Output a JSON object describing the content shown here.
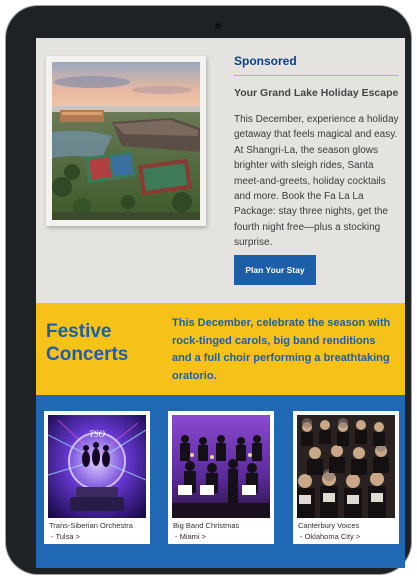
{
  "sponsored": {
    "label": "Sponsored",
    "title": "Your Grand Lake Holiday Escape",
    "body": "This December, experience a holiday getaway that feels magical and easy. At Shangri-La, the season glows brighter with sleigh rides, Santa meet-and-greets, holiday cocktails and more. Book the Fa La La Package: stay three nights, get the fourth night free—plus a stocking surprise.",
    "button_label": "Plan Your Stay"
  },
  "festive": {
    "title": "Festive Concerts",
    "body": "This December, celebrate the season with rock-tinged carols, big band renditions and a full choir performing a breathtaking oratorio."
  },
  "concerts": [
    {
      "name": "Trans-Siberian Orchestra",
      "city": "- Tulsa >"
    },
    {
      "name": "Big Band Christmas",
      "city": "- Miami >"
    },
    {
      "name": "Canterbury Voices",
      "city": "- Oklahoma City >"
    }
  ],
  "colors": {
    "brand_blue": "#1d5ea8",
    "accent_yellow": "#f6c21a",
    "panel_gray": "#e4e3df"
  }
}
